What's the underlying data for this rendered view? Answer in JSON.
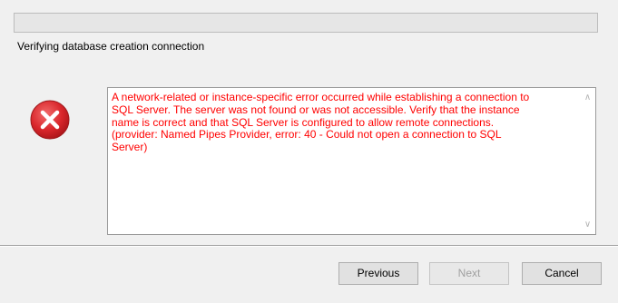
{
  "progress": {
    "value_percent": 0
  },
  "status": {
    "text": "Verifying database creation connection"
  },
  "error": {
    "icon": "error-x-icon",
    "message": "A network-related or instance-specific error occurred while establishing a connection to\nSQL Server. The server was not found or was not accessible. Verify that the instance\nname is correct and that SQL Server is configured to allow remote connections.\n(provider: Named Pipes Provider, error: 40 - Could not open a connection to SQL\nServer)"
  },
  "buttons": {
    "previous": "Previous",
    "next": "Next",
    "cancel": "Cancel"
  },
  "colors": {
    "error_text": "#ff0000",
    "icon_red": "#d9262b",
    "window_bg": "#f0f0f0"
  }
}
